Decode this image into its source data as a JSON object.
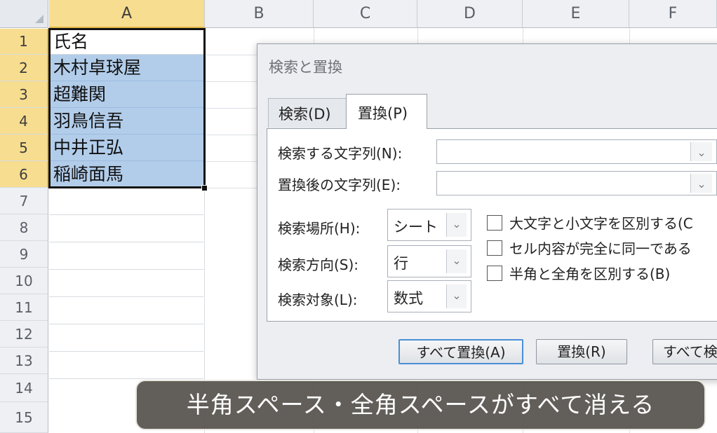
{
  "columns": [
    "A",
    "B",
    "C",
    "D",
    "E",
    "F"
  ],
  "rows": [
    "1",
    "2",
    "3",
    "4",
    "5",
    "6",
    "7",
    "8",
    "9",
    "10",
    "11",
    "12",
    "13",
    "14",
    "15"
  ],
  "cells": {
    "A1": "氏名",
    "A2": "木村卓球屋",
    "A3": "超難関",
    "A4": "羽鳥信吾",
    "A5": "中井正弘",
    "A6": "稲崎面馬"
  },
  "dialog": {
    "title": "検索と置換",
    "tabs": {
      "search": "検索(D)",
      "replace": "置換(P)"
    },
    "find_label": "検索する文字列(N):",
    "find_value": "",
    "replace_label": "置換後の文字列(E):",
    "replace_value": "",
    "within_label": "検索場所(H):",
    "within_value": "シート",
    "direction_label": "検索方向(S):",
    "direction_value": "行",
    "lookin_label": "検索対象(L):",
    "lookin_value": "数式",
    "options": [
      {
        "label": "大文字と小文字を区別する(C",
        "checked": false
      },
      {
        "label": "セル内容が完全に同一である",
        "checked": false
      },
      {
        "label": "半角と全角を区別する(B)",
        "checked": false
      }
    ],
    "buttons": {
      "replace_all": "すべて置換(A)",
      "replace": "置換(R)",
      "find_all": "すべて検"
    }
  },
  "caption": "半角スペース・全角スペースがすべて消える",
  "colors": {
    "selected_header": "#f7dd8f",
    "selection_fill": "#b2cdea",
    "caption_bg": "#56524e"
  },
  "icons": {
    "dropdown": "chevron-down-icon",
    "checkbox": "checkbox-icon"
  }
}
